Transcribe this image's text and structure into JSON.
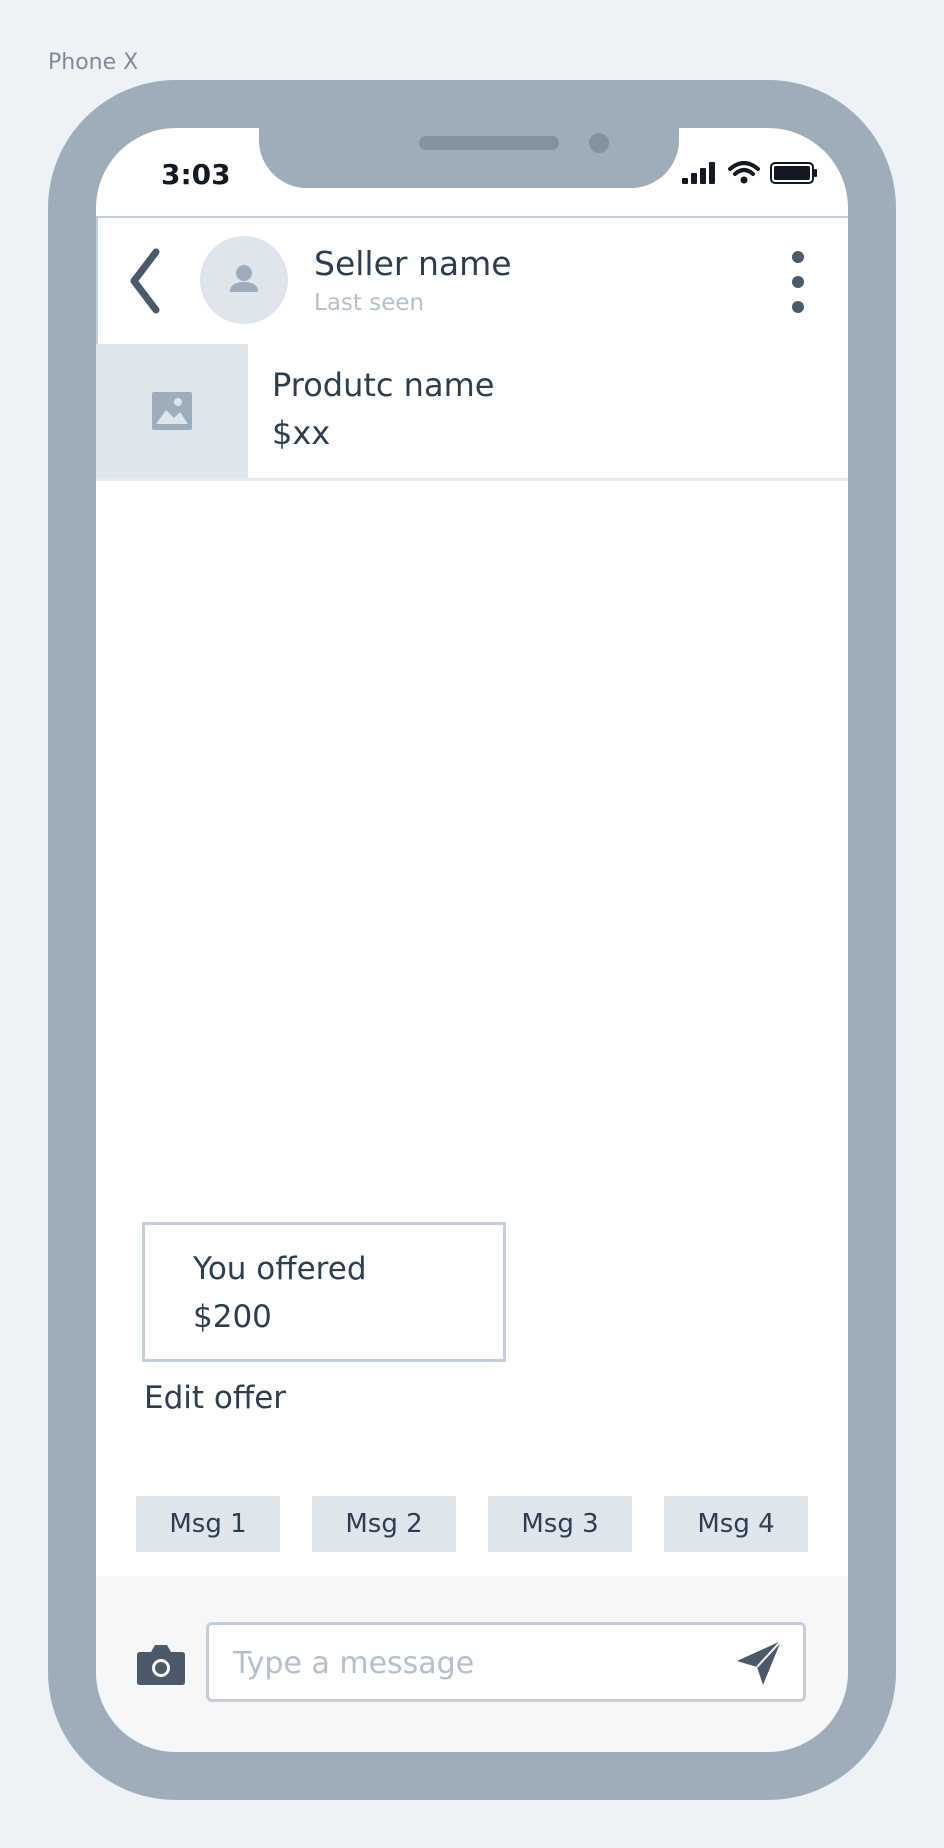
{
  "frame": {
    "label": "Phone X"
  },
  "status_bar": {
    "time": "3:03",
    "icons": [
      "signal-icon",
      "wifi-icon",
      "battery-icon"
    ]
  },
  "header": {
    "seller_name": "Seller name",
    "last_seen": "Last seen",
    "icons": {
      "back": "chevron-left-icon",
      "avatar": "user-icon",
      "menu": "more-vertical-icon"
    }
  },
  "product": {
    "name": "Produtc name",
    "price": "$xx",
    "icon": "image-icon"
  },
  "offer": {
    "label": "You offered",
    "amount": "$200",
    "edit_label": "Edit offer"
  },
  "quick_replies": [
    "Msg 1",
    "Msg 2",
    "Msg 3",
    "Msg 4"
  ],
  "composer": {
    "placeholder": "Type a message",
    "value": "",
    "icons": {
      "camera": "camera-icon",
      "send": "send-icon"
    }
  },
  "colors": {
    "device": "#9eadba",
    "text": "#2c3e50",
    "muted": "#b4c0cb",
    "chip": "#dfe5ec",
    "border": "#c4ced8",
    "icon": "#4a5a69"
  }
}
